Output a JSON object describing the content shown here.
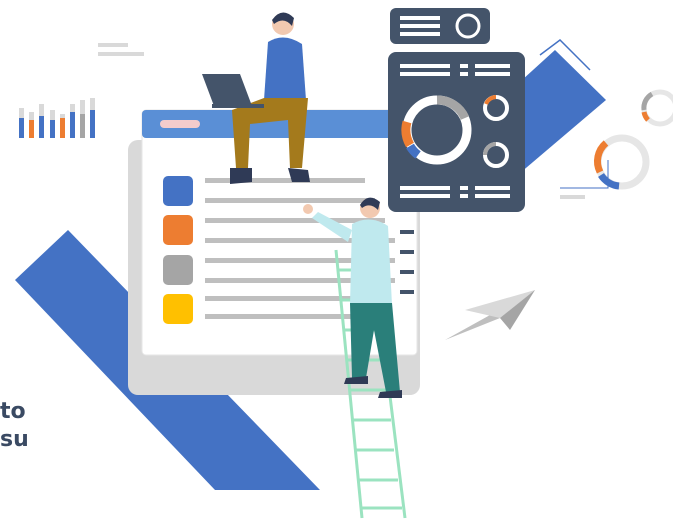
{
  "caption": {
    "line1": "to",
    "line2": "su"
  },
  "colors": {
    "blue": "#4472c4",
    "orange": "#ed7d31",
    "gray": "#a5a5a5",
    "yellow": "#ffc000",
    "dark_panel": "#44546a",
    "light_gray": "#d9d9d9",
    "ladder_green": "#9be3c0"
  },
  "icons": [
    "illustration",
    "bar-chart-icon",
    "document-window-icon",
    "dashboard-panel-icon",
    "donut-chart-icon",
    "paper-plane-icon",
    "ladder-icon",
    "person-with-laptop",
    "person-on-ladder"
  ]
}
